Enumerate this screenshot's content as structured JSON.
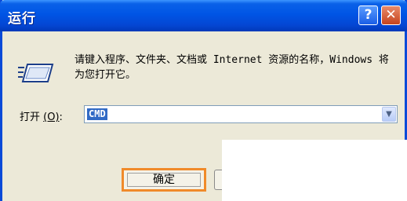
{
  "window": {
    "title": "运行"
  },
  "titlebar_buttons": {
    "help": "?",
    "close": "✕"
  },
  "icon": {
    "name": "run-icon"
  },
  "description": "请键入程序、文件夹、文档或 Internet 资源的名称，Windows 将为您打开它。",
  "open_field": {
    "label_prefix": "打开",
    "label_accel": "(O)",
    "label_suffix": ":",
    "value": "CMD"
  },
  "buttons": {
    "ok": "确定"
  },
  "colors": {
    "titlebar": "#0055e5",
    "dialog_bg": "#ece9d8",
    "focus_border": "#f08a2a",
    "selection": "#316ac5"
  }
}
